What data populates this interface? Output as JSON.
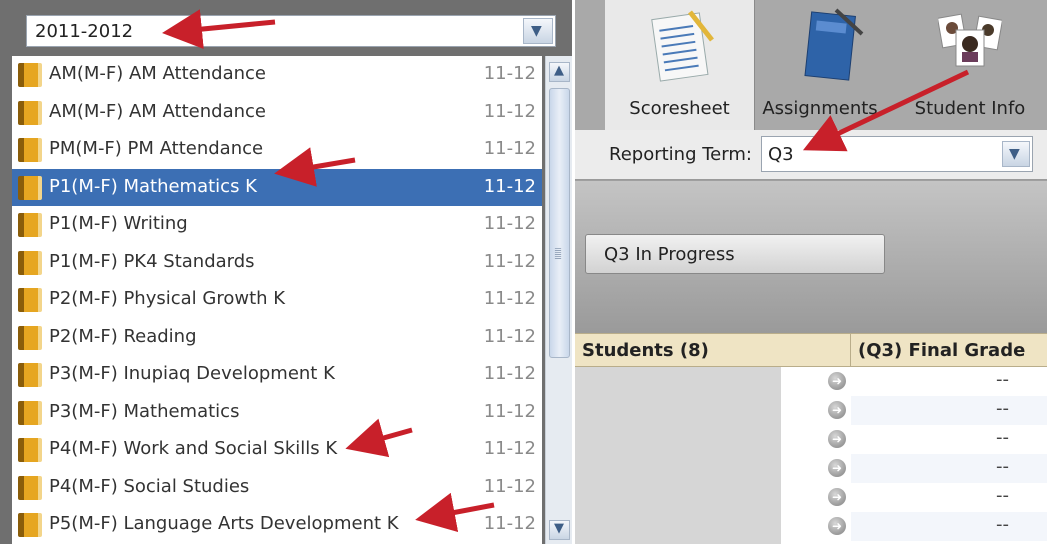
{
  "year_selector": {
    "value": "2011-2012"
  },
  "courses": [
    {
      "name": "AM(M-F) AM Attendance",
      "year": "11-12",
      "selected": false
    },
    {
      "name": "AM(M-F) AM Attendance",
      "year": "11-12",
      "selected": false
    },
    {
      "name": "PM(M-F) PM Attendance",
      "year": "11-12",
      "selected": false
    },
    {
      "name": "P1(M-F) Mathematics K",
      "year": "11-12",
      "selected": true
    },
    {
      "name": "P1(M-F) Writing",
      "year": "11-12",
      "selected": false
    },
    {
      "name": "P1(M-F) PK4 Standards",
      "year": "11-12",
      "selected": false
    },
    {
      "name": "P2(M-F) Physical Growth K",
      "year": "11-12",
      "selected": false
    },
    {
      "name": "P2(M-F) Reading",
      "year": "11-12",
      "selected": false
    },
    {
      "name": "P3(M-F) Inupiaq Development K",
      "year": "11-12",
      "selected": false
    },
    {
      "name": "P3(M-F) Mathematics",
      "year": "11-12",
      "selected": false
    },
    {
      "name": "P4(M-F) Work and Social Skills K",
      "year": "11-12",
      "selected": false
    },
    {
      "name": "P4(M-F) Social Studies",
      "year": "11-12",
      "selected": false
    },
    {
      "name": "P5(M-F) Language Arts Development K",
      "year": "11-12",
      "selected": false
    }
  ],
  "tabs": [
    {
      "label": "Scoresheet",
      "active": true
    },
    {
      "label": "Assignments",
      "active": false
    },
    {
      "label": "Student Info",
      "active": false
    }
  ],
  "reporting_term": {
    "label": "Reporting Term:",
    "value": "Q3"
  },
  "progress_button": {
    "label": "Q3 In Progress"
  },
  "grid": {
    "students_header": "Students (8)",
    "grade_header": "(Q3) Final Grade",
    "rows": [
      "--",
      "--",
      "--",
      "--",
      "--",
      "--"
    ]
  },
  "colors": {
    "selection": "#3c6fb4",
    "annotation_arrow": "#c8202a",
    "header_bg": "#efe4c4"
  },
  "icons": {
    "course": "book-icon",
    "dropdown": "chevron-down-icon",
    "row_action": "arrow-right-circle-icon"
  }
}
